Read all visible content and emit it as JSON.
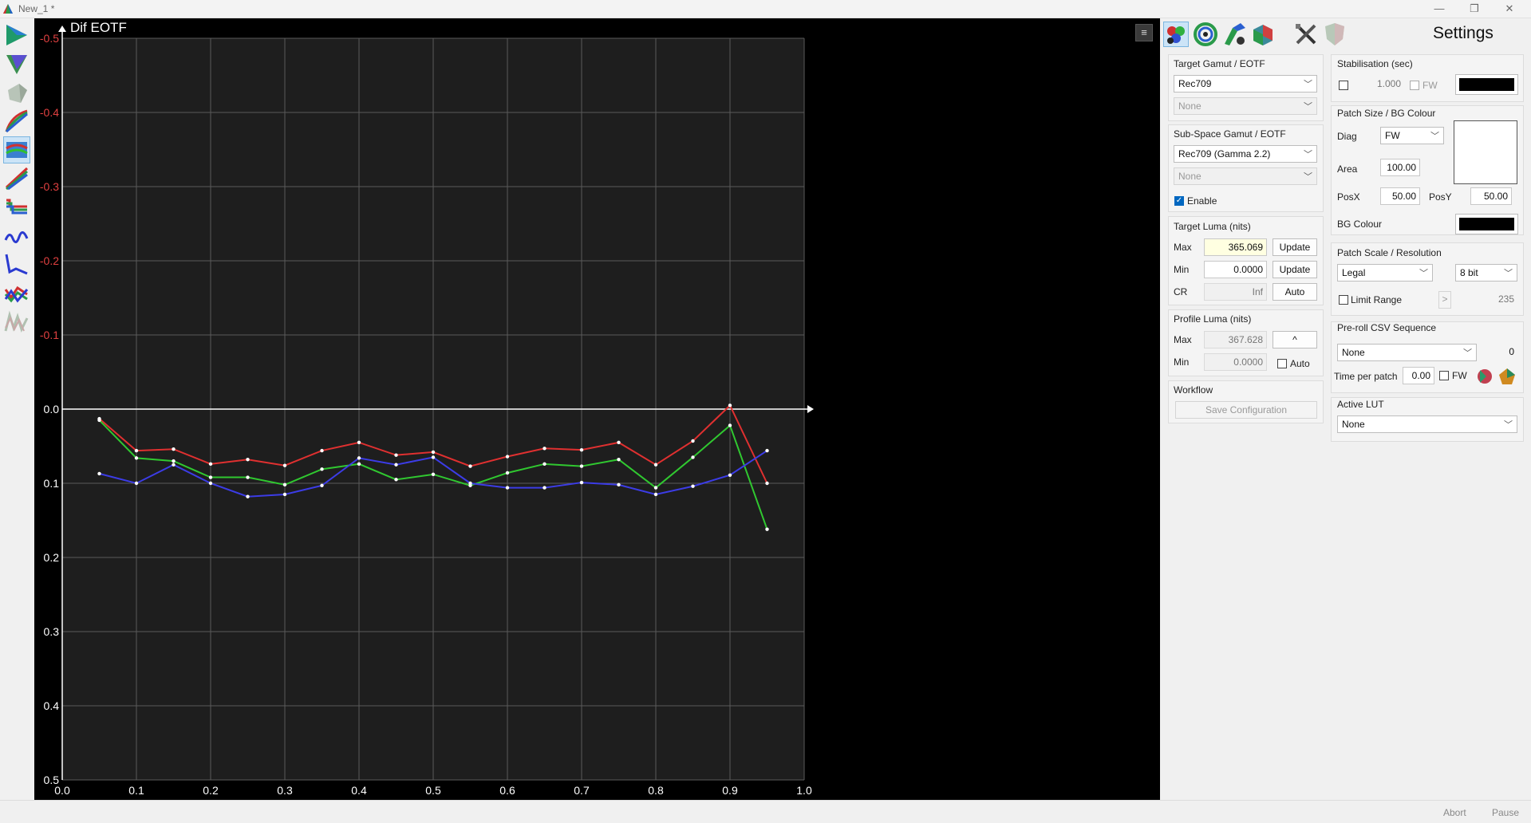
{
  "window": {
    "title": "New_1 *",
    "minimize_glyph": "—",
    "restore_glyph": "❐",
    "close_glyph": "✕"
  },
  "graph": {
    "title": "Dif EOTF",
    "menu_glyph": "≡",
    "colors": {
      "background": "#1e1e1e",
      "grid": "#5a5a5a",
      "zero_axis": "#ffffff",
      "red": "#e03030",
      "green": "#30c830",
      "blue": "#3c3ce6",
      "negative_label": "#e04040",
      "positive_label": "#ffffff"
    }
  },
  "chart_data": {
    "type": "line",
    "title": "Dif EOTF",
    "xlabel": "",
    "ylabel": "",
    "xlim": [
      0.0,
      1.0
    ],
    "ylim": [
      -0.5,
      0.5
    ],
    "y_inverted": true,
    "grid": true,
    "x_ticks": [
      "0.0",
      "0.1",
      "0.2",
      "0.3",
      "0.4",
      "0.5",
      "0.6",
      "0.7",
      "0.8",
      "0.9",
      "1.0"
    ],
    "y_ticks": [
      "-0.5",
      "-0.4",
      "-0.3",
      "-0.2",
      "-0.1",
      "0.0",
      "0.1",
      "0.2",
      "0.3",
      "0.4",
      "0.5"
    ],
    "x": [
      0.05,
      0.1,
      0.15,
      0.2,
      0.25,
      0.3,
      0.35,
      0.4,
      0.45,
      0.5,
      0.55,
      0.6,
      0.65,
      0.7,
      0.75,
      0.8,
      0.85,
      0.9,
      0.95
    ],
    "series": [
      {
        "color": "#e03030",
        "values": [
          0.013,
          0.056,
          0.054,
          0.074,
          0.068,
          0.076,
          0.056,
          0.045,
          0.062,
          0.058,
          0.077,
          0.064,
          0.053,
          0.055,
          0.045,
          0.075,
          0.043,
          -0.005,
          0.1
        ]
      },
      {
        "color": "#30c830",
        "values": [
          0.015,
          0.066,
          0.07,
          0.092,
          0.092,
          0.102,
          0.081,
          0.074,
          0.095,
          0.088,
          0.103,
          0.086,
          0.074,
          0.077,
          0.068,
          0.106,
          0.065,
          0.022,
          0.162
        ]
      },
      {
        "color": "#3c3ce6",
        "values": [
          0.087,
          0.1,
          0.075,
          0.1,
          0.118,
          0.115,
          0.103,
          0.066,
          0.075,
          0.065,
          0.1,
          0.106,
          0.106,
          0.099,
          0.102,
          0.115,
          0.104,
          0.089,
          0.056
        ]
      }
    ]
  },
  "left_toolbar": {
    "tools": [
      {
        "name": "cie-diagram-tool",
        "active": false
      },
      {
        "name": "gamut-triangle-tool",
        "active": false
      },
      {
        "name": "3d-gamut-tool",
        "active": false
      },
      {
        "name": "eotf-curves-tool",
        "active": false
      },
      {
        "name": "dif-eotf-tool",
        "active": true
      },
      {
        "name": "rgb-curves-tool",
        "active": false
      },
      {
        "name": "rgb-balance-tool",
        "active": false
      },
      {
        "name": "de-graph-tool",
        "active": false
      },
      {
        "name": "luma-graph-tool",
        "active": false
      },
      {
        "name": "multi-graph-tool",
        "active": false
      },
      {
        "name": "spectrum-tool",
        "active": false
      }
    ]
  },
  "settings": {
    "title": "Settings",
    "target_gamut": {
      "title": "Target Gamut / EOTF",
      "gamut": "Rec709",
      "eotf": "None"
    },
    "sub_space": {
      "title": "Sub-Space  Gamut / EOTF",
      "gamut": "Rec709 (Gamma 2.2)",
      "eotf": "None",
      "enable_label": "Enable",
      "enabled": true
    },
    "target_luma": {
      "title": "Target Luma (nits)",
      "max_label": "Max",
      "max_value": "365.069",
      "min_label": "Min",
      "min_value": "0.0000",
      "cr_label": "CR",
      "cr_value": "Inf",
      "update_label": "Update",
      "auto_label": "Auto"
    },
    "profile_luma": {
      "title": "Profile Luma (nits)",
      "max_label": "Max",
      "max_value": "367.628",
      "up_label": "^",
      "min_label": "Min",
      "min_value": "0.0000",
      "auto_label": "Auto"
    },
    "workflow": {
      "title": "Workflow",
      "save_label": "Save Configuration"
    },
    "stabilisation": {
      "title": "Stabilisation (sec)",
      "value": "1.000",
      "fw_label": "FW"
    },
    "patch_size": {
      "title": "Patch Size / BG Colour",
      "diag_label": "Diag",
      "diag_value": "FW",
      "area_label": "Area",
      "area_value": "100.00",
      "posx_label": "PosX",
      "posx_value": "50.00",
      "posy_label": "PosY",
      "posy_value": "50.00",
      "bg_label": "BG Colour"
    },
    "patch_scale": {
      "title": "Patch Scale / Resolution",
      "scale": "Legal",
      "resolution": "8 bit",
      "limit_label": "Limit Range",
      "limit_op": ">",
      "limit_value": "235"
    },
    "preroll": {
      "title": "Pre-roll CSV Sequence",
      "sequence": "None",
      "count": "0",
      "time_label": "Time per patch",
      "time_value": "0.00",
      "fw_label": "FW"
    },
    "active_lut": {
      "title": "Active LUT",
      "value": "None"
    }
  },
  "status": {
    "abort_label": "Abort",
    "pause_label": "Pause"
  }
}
